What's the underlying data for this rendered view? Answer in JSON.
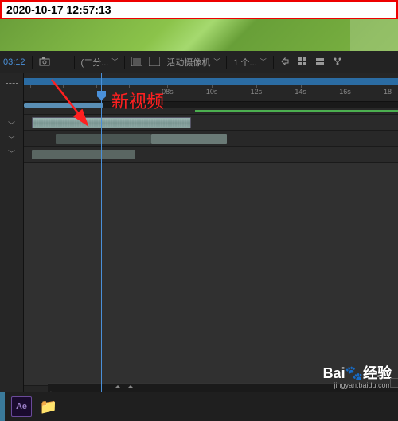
{
  "timestamp": "2020-10-17 12:57:13",
  "toolbar": {
    "timecode": "03:12",
    "resolution_label": "(二分...",
    "camera_label": "活动摄像机",
    "view_count": "1 个..."
  },
  "ruler": {
    "ticks": [
      "",
      "",
      "",
      "",
      "08s",
      "10s",
      "12s",
      "14s",
      "16s",
      "18"
    ]
  },
  "annotation": "新视频",
  "taskbar": {
    "ae": "Ae"
  },
  "watermark": {
    "brand_prefix": "Bai",
    "brand_suffix": "经验",
    "url": "jingyan.baidu.com"
  }
}
